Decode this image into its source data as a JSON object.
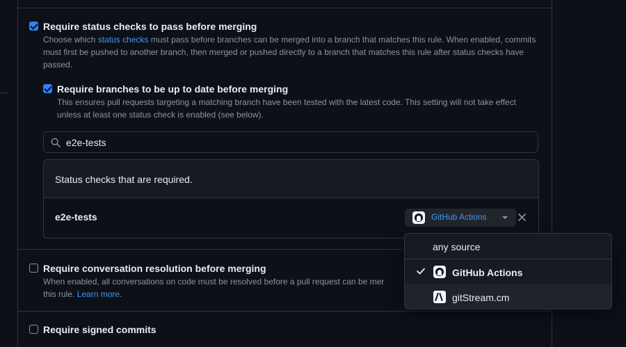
{
  "status_checks": {
    "title": "Require status checks to pass before merging",
    "desc_pre": "Choose which ",
    "desc_link": "status checks",
    "desc_post": " must pass before branches can be merged into a branch that matches this rule. When enabled, commits must first be pushed to another branch, then merged or pushed directly to a branch that matches this rule after status checks have passed.",
    "checked": true
  },
  "up_to_date": {
    "title": "Require branches to be up to date before merging",
    "desc": "This ensures pull requests targeting a matching branch have been tested with the latest code. This setting will not take effect unless at least one status check is enabled (see below).",
    "checked": true
  },
  "search": {
    "value": "e2e-tests"
  },
  "required_checks": {
    "header": "Status checks that are required.",
    "rows": [
      {
        "name": "e2e-tests",
        "source": "GitHub Actions"
      }
    ]
  },
  "source_menu": {
    "items": [
      {
        "label": "any source",
        "selected": false
      },
      {
        "label": "GitHub Actions",
        "selected": true
      },
      {
        "label": "gitStream.cm",
        "selected": false
      }
    ]
  },
  "conversation": {
    "title": "Require conversation resolution before merging",
    "desc_pre": "When enabled, all conversations on code must be resolved before a pull request can be mer",
    "desc_line2": "this rule. ",
    "desc_link": "Learn more",
    "desc_end": ".",
    "checked": false
  },
  "signed_commits": {
    "title": "Require signed commits",
    "checked": false
  },
  "colors": {
    "background": "#0d1117",
    "accent": "#2f81f7",
    "link": "#4493f8",
    "border": "#30363d",
    "muted_text": "#8b949e"
  }
}
